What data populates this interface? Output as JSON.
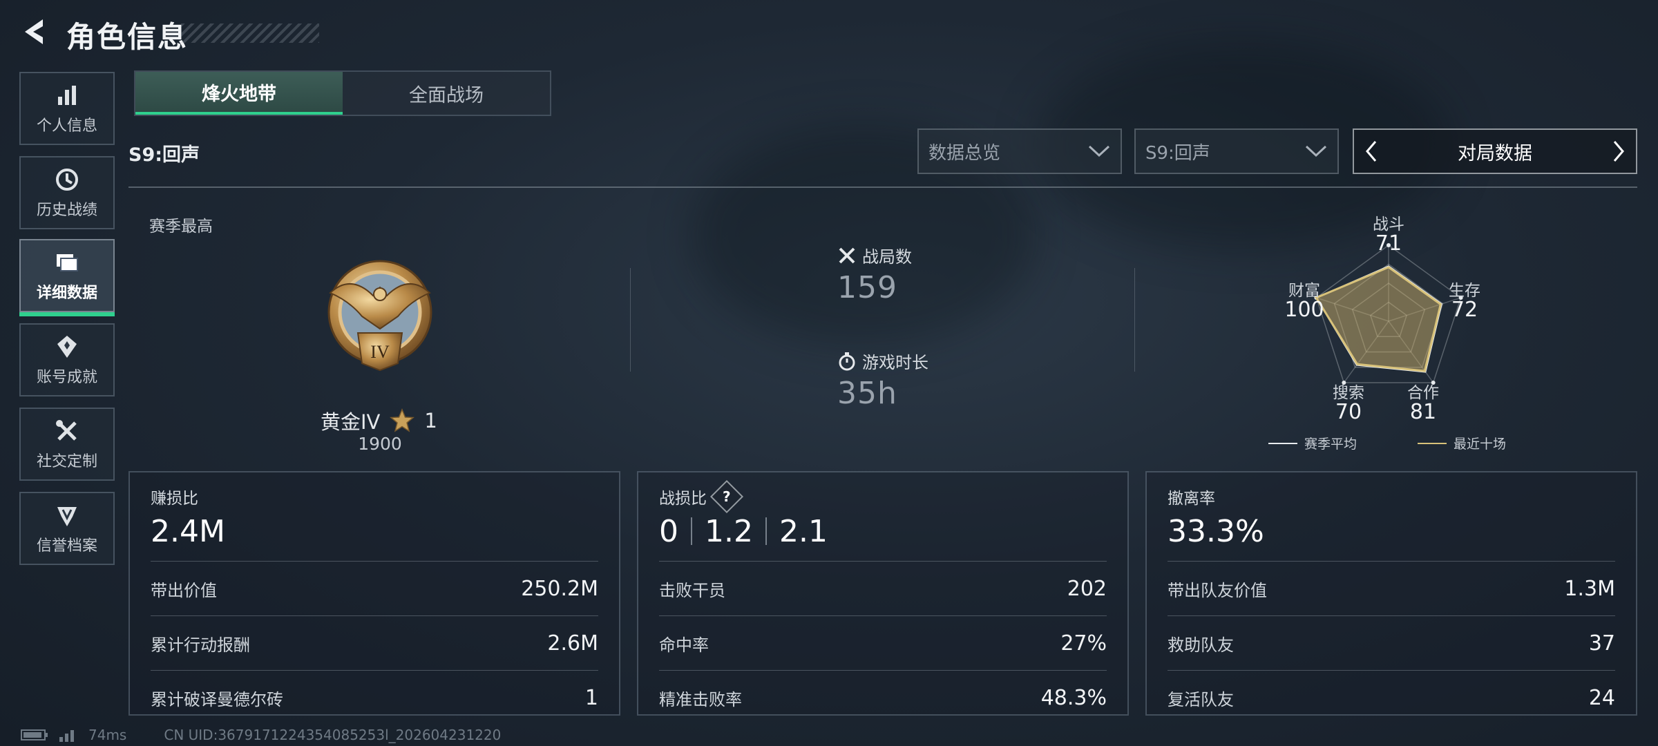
{
  "header": {
    "title": "角色信息"
  },
  "sidebar": {
    "items": [
      {
        "label": "个人信息",
        "icon": "bar-chart-icon",
        "active": false
      },
      {
        "label": "历史战绩",
        "icon": "clock-icon",
        "active": false
      },
      {
        "label": "详细数据",
        "icon": "folder-icon",
        "active": true
      },
      {
        "label": "账号成就",
        "icon": "achievement-icon",
        "active": false
      },
      {
        "label": "社交定制",
        "icon": "wrench-tools-icon",
        "active": false
      },
      {
        "label": "信誉档案",
        "icon": "shield-emblem-icon",
        "active": false
      }
    ]
  },
  "mode_tabs": [
    {
      "label": "烽火地带",
      "active": true
    },
    {
      "label": "全面战场",
      "active": false
    }
  ],
  "season_label": "S9:回声",
  "filters": {
    "view": "数据总览",
    "season": "S9:回声",
    "pager_label": "对局数据"
  },
  "rank": {
    "caption": "赛季最高",
    "name": "黄金IV",
    "stars": "1",
    "score": "1900",
    "medal_numeral": "IV"
  },
  "summary": {
    "matches_label": "战局数",
    "matches_value": "159",
    "playtime_label": "游戏时长",
    "playtime_value": "35h"
  },
  "radar": {
    "axes": [
      {
        "label": "战斗",
        "value": "71"
      },
      {
        "label": "生存",
        "value": "72"
      },
      {
        "label": "合作",
        "value": "81"
      },
      {
        "label": "搜索",
        "value": "70"
      },
      {
        "label": "财富",
        "value": "100"
      }
    ],
    "legend_avg": "赛季平均",
    "legend_recent": "最近十场",
    "colors": {
      "avg": "#e8ecef",
      "recent": "#d8c27a",
      "fill": "#c9ad6a"
    }
  },
  "cards": {
    "profit": {
      "title": "赚损比",
      "main": "2.4M",
      "rows": [
        {
          "label": "带出价值",
          "value": "250.2M"
        },
        {
          "label": "累计行动报酬",
          "value": "2.6M"
        },
        {
          "label": "累计破译曼德尔砖",
          "value": "1"
        }
      ]
    },
    "combat": {
      "title": "战损比",
      "ratios": [
        "0",
        "1.2",
        "2.1"
      ],
      "rows": [
        {
          "label": "击败干员",
          "value": "202"
        },
        {
          "label": "命中率",
          "value": "27%"
        },
        {
          "label": "精准击败率",
          "value": "48.3%"
        }
      ]
    },
    "extract": {
      "title": "撤离率",
      "main": "33.3%",
      "rows": [
        {
          "label": "带出队友价值",
          "value": "1.3M"
        },
        {
          "label": "救助队友",
          "value": "37"
        },
        {
          "label": "复活队友",
          "value": "24"
        }
      ]
    }
  },
  "footer": {
    "ping": "74ms",
    "uid": "CN UID:3679171224354085253l_202604231220"
  },
  "colors": {
    "accent": "#2fd08e",
    "gold": "#c9a15a"
  }
}
